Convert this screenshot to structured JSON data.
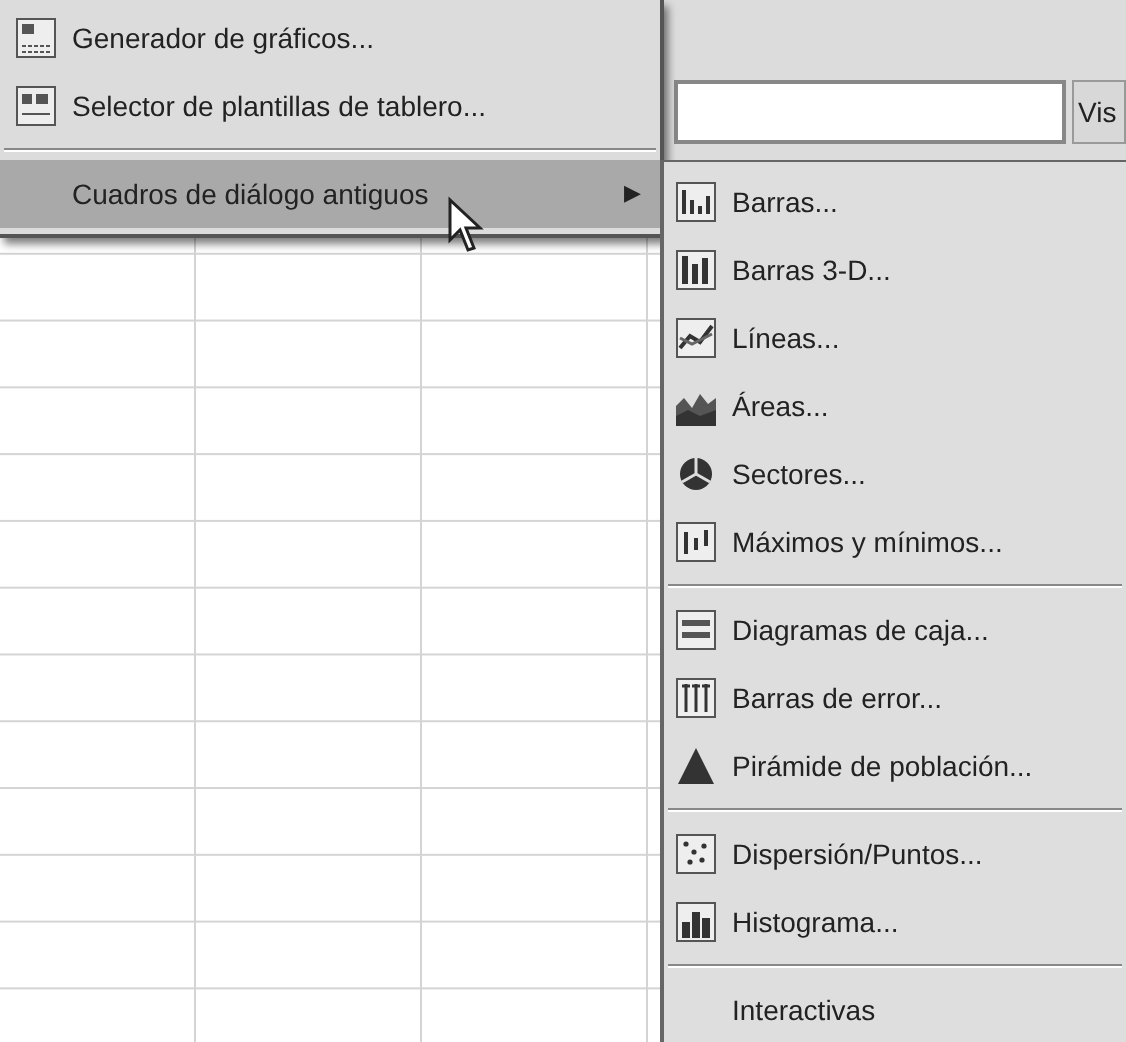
{
  "toolbar": {
    "button": "Vis"
  },
  "menu": {
    "items": [
      {
        "kind": "item",
        "label": "Generador de gráficos...",
        "selected": false
      },
      {
        "kind": "item",
        "label": "Selector de plantillas de tablero...",
        "selected": false
      },
      {
        "kind": "separator"
      },
      {
        "kind": "submenu",
        "label": "Cuadros de diálogo antiguos",
        "arrow": "▶",
        "selected": true
      }
    ]
  },
  "submenu": {
    "items": [
      {
        "kind": "item",
        "label": "Barras..."
      },
      {
        "kind": "item",
        "label": "Barras 3-D..."
      },
      {
        "kind": "item",
        "label": "Líneas..."
      },
      {
        "kind": "item",
        "label": "Áreas..."
      },
      {
        "kind": "item",
        "label": "Sectores..."
      },
      {
        "kind": "item",
        "label": "Máximos y mínimos..."
      },
      {
        "kind": "separator"
      },
      {
        "kind": "item",
        "label": "Diagramas de caja..."
      },
      {
        "kind": "item",
        "label": "Barras de error..."
      },
      {
        "kind": "item",
        "label": "Pirámide de población..."
      },
      {
        "kind": "separator"
      },
      {
        "kind": "item",
        "label": "Dispersión/Puntos..."
      },
      {
        "kind": "item",
        "label": "Histograma..."
      },
      {
        "kind": "separator"
      },
      {
        "kind": "item",
        "label": "Interactivas"
      }
    ]
  }
}
